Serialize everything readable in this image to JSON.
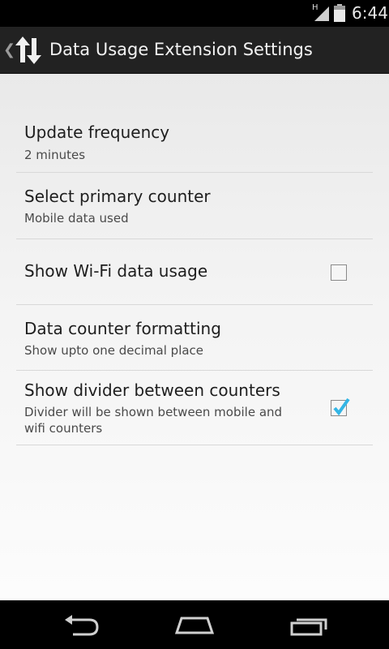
{
  "status_bar": {
    "network_type": "H",
    "time": "6:44",
    "icons": [
      "signal-icon",
      "battery-icon"
    ]
  },
  "action_bar": {
    "title": "Data Usage Extension Settings",
    "icons": [
      "up-caret-icon",
      "data-arrows-icon"
    ]
  },
  "preferences": [
    {
      "title": "Update frequency",
      "summary": "2 minutes"
    },
    {
      "title": "Select primary counter",
      "summary": "Mobile data used"
    },
    {
      "title": "Show Wi-Fi data usage",
      "summary": "",
      "checked": false
    },
    {
      "title": "Data counter formatting",
      "summary": "Show upto one decimal place"
    },
    {
      "title": "Show divider between counters",
      "summary": "Divider will be shown between mobile and wifi counters",
      "checked": true
    }
  ],
  "nav_bar": {
    "icons": [
      "back-icon",
      "home-icon",
      "recents-icon"
    ]
  },
  "colors": {
    "accent": "#33b5e5",
    "action_bar": "#222222"
  }
}
